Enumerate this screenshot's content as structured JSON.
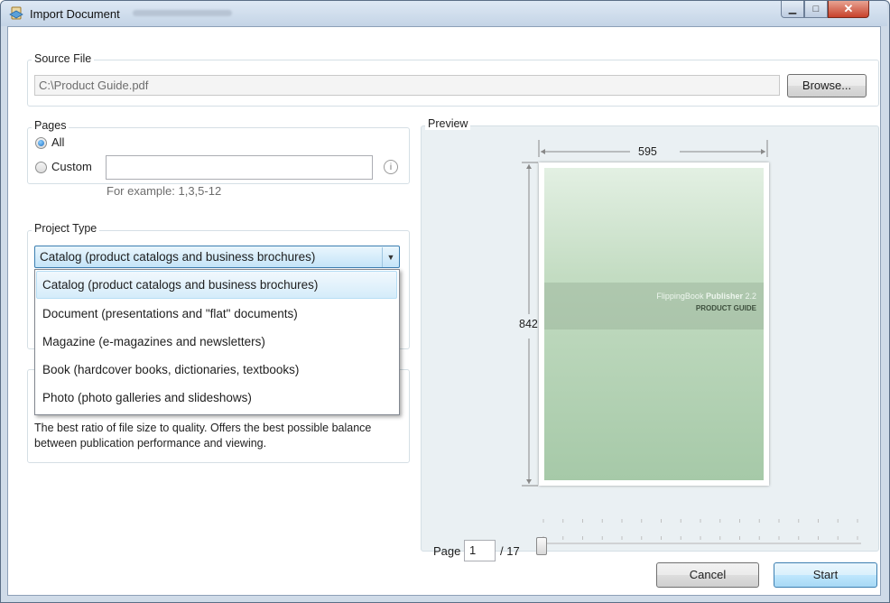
{
  "window": {
    "title": "Import Document"
  },
  "source_file": {
    "legend": "Source File",
    "path": "C:\\Product Guide.pdf",
    "browse_label": "Browse..."
  },
  "pages": {
    "legend": "Pages",
    "all_label": "All",
    "custom_label": "Custom",
    "custom_value": "",
    "hint": "For example: 1,3,5-12"
  },
  "project_type": {
    "legend": "Project Type",
    "selected": "Catalog (product catalogs and business brochures)",
    "options": [
      "Catalog (product catalogs and business brochures)",
      "Document (presentations and \"flat\" documents)",
      "Magazine (e-magazines and newsletters)",
      "Book (hardcover books, dictionaries, textbooks)",
      "Photo (photo galleries and slideshows)"
    ]
  },
  "quality": {
    "description": "The best ratio of file size to quality. Offers the best possible balance between publication performance and viewing."
  },
  "preview": {
    "legend": "Preview",
    "width_label": "595",
    "height_label": "842",
    "cover_brand": "FlippingBook",
    "cover_product": "Publisher",
    "cover_version": "2.2",
    "cover_subtitle": "PRODUCT GUIDE",
    "page_label": "Page",
    "page_value": "1",
    "page_total": "/ 17",
    "slider_fraction": 0
  },
  "footer": {
    "cancel_label": "Cancel",
    "start_label": "Start"
  },
  "colors": {
    "accent": "#3c7fb1",
    "selection": "#d5ecfa",
    "cover_green": "#a6c9a8"
  }
}
